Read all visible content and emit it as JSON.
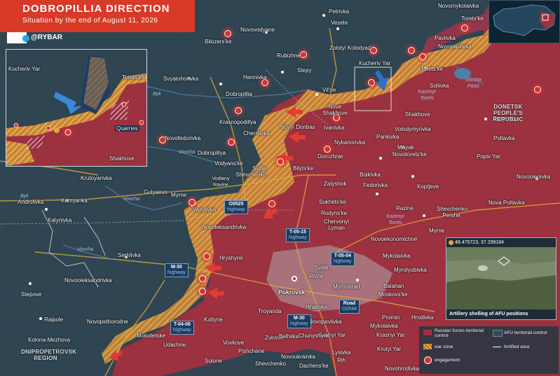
{
  "header": {
    "title": "DOBROPILLIA DIRECTION",
    "subtitle": "Situation by the end of August 11, 2026",
    "brand": "@RYBAR"
  },
  "colors": {
    "russian_control": "#a83642",
    "afu_control": "#34495a",
    "war_zone": "#e8a33c",
    "engagement": "#d9322c",
    "accent": "#d73b27"
  },
  "icons": [
    "telegram-icon",
    "qr-code-icon",
    "engagement-icon",
    "attack-arrow-icon",
    "artillery-icon",
    "camera-icon"
  ],
  "inset": {
    "label_quarries": "Quarries",
    "label_kucheriv_yar": "Kucheriv Yar",
    "label_toretske": "Torets'ke",
    "label_shakhove": "Shakhove"
  },
  "photo": {
    "coords": "48.475723, 37.299184",
    "caption": "Artillery shelling of AFU positions"
  },
  "legend": {
    "russian": "Russian forces territorial control",
    "afu": "AFU territorial control",
    "war_zone": "war zone",
    "fortified": "fortified area",
    "engagement": "engagement"
  },
  "regions": {
    "donetsk": "DONETSK PEOPLE'S REPUBLIC",
    "dnipro": "DNIPROPETROVSK REGION"
  },
  "rivers": [
    "Byk",
    "Vovcha",
    "Byk",
    "Vovcha",
    "Kazenyi Torets",
    "Kazenyi Torets",
    "Vovcha"
  ],
  "ponds": [
    "Vovcha Pond"
  ],
  "highways": [
    {
      "code": "O0525",
      "word": "highway"
    },
    {
      "code": "T-05-15",
      "word": "highway"
    },
    {
      "code": "T-05-04",
      "word": "highway"
    },
    {
      "code": "M-30",
      "word": "highway"
    },
    {
      "code": "M-30",
      "word": "highway"
    },
    {
      "code": "T-04-06",
      "word": "highway"
    },
    {
      "code": "Road",
      "word": "O0544"
    }
  ],
  "places": [
    "Petrivka",
    "Novomykolaivka",
    "Novovodyane",
    "Vesele",
    "Bilozers'ke",
    "Zolotyi Kolodyaz'",
    "Rubizhne",
    "Stepy",
    "Kucheriv Yar",
    "Torets'ke",
    "Pavlivka",
    "Novopavlivka",
    "Svyatohorivka",
    "Hannivka",
    "Dobropillia",
    "Vil'ne",
    "Torets'ke",
    "Soliivka",
    "Nove Shakhove",
    "Novyi Donbas",
    "Ivanivka",
    "Shakhove",
    "Rusyn Yar",
    "Novofedorivka",
    "Krasnopodillya",
    "Volodymyrivka",
    "Pankivka",
    "Cherniivka",
    "Nykanorivka",
    "Mayak",
    "Poltavka",
    "Dobropillya",
    "Vodyans'ke",
    "Dorozhnie",
    "Novotorets'ke",
    "Popiv Yar",
    "Vodiany Ravine",
    "Svitle",
    "Bilyts'ke",
    "Shevchenko",
    "Boikivka",
    "Novoolenivka",
    "Krutoyarivka",
    "Zatyshok",
    "Fedorivka",
    "Gulyaevo",
    "Myrne",
    "Koptjeve",
    "Androlivka",
    "Kamyanka",
    "Vasylivka",
    "Sukhets'ke",
    "Razine",
    "Nova Poltavka",
    "Shevchenko Pershe",
    "Novoleksandrivka",
    "Rodyns'ke",
    "Chervonyi Lyman",
    "Kalynivka",
    "Myrne",
    "Novoekonomichne",
    "Serhiivka",
    "Hryshyne",
    "Mykolaivka",
    "Novooleksandrivka",
    "Myrolyubivka",
    "Svitle",
    "Rivne",
    "Stepove",
    "Pokrovsk",
    "Myrnohrad",
    "Balahan",
    "Moskovs'ke",
    "Troyanda",
    "Hnativka",
    "Raipole",
    "Novopidhorodne",
    "Promin",
    "Hrodivka",
    "Kotlyne",
    "Novopavlivka",
    "Mykolaivka",
    "Kolona-Mezhova",
    "Krasnyi Yar",
    "Sukhyi Yar",
    "Molodetske",
    "Vovkove",
    "Zvirove",
    "Belhiika",
    "Chunyshyne",
    "Udachne",
    "Pishchane",
    "Lysivka",
    "Krutyi Yar",
    "Solone",
    "Novoukrainka",
    "Rih",
    "Shevchenko",
    "Dachens'ke",
    "Novohrodivka"
  ]
}
